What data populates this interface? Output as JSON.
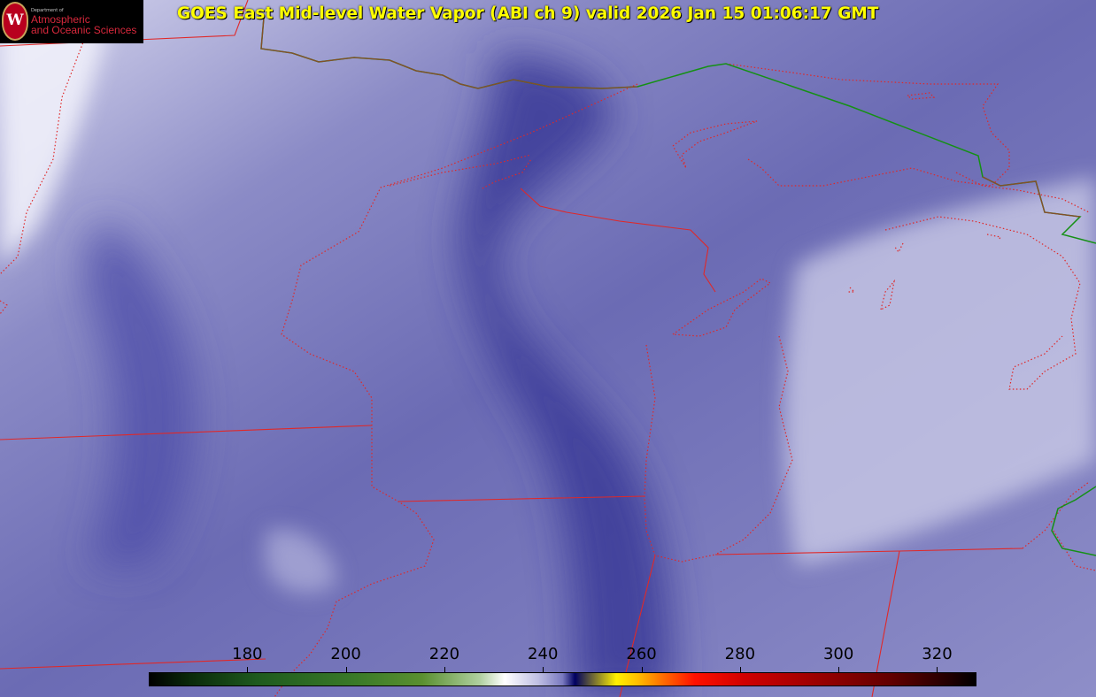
{
  "title": "GOES East Mid-level Water Vapor (ABI ch 9)  valid 2026 Jan 15 01:06:17 GMT",
  "logo": {
    "department": "Department of",
    "line1": "Atmospheric",
    "line2": "and Oceanic Sciences",
    "seal_letter": "W"
  },
  "colorbar": {
    "unit_range": [
      160,
      328
    ],
    "ticks": [
      "180",
      "200",
      "220",
      "240",
      "260",
      "280",
      "300",
      "320"
    ],
    "tick_values": [
      180,
      200,
      220,
      240,
      260,
      280,
      300,
      320
    ]
  },
  "colors": {
    "background": "#7474b4",
    "state_borders": "#e02828",
    "international_border": "#159015",
    "title": "#ffff00"
  }
}
